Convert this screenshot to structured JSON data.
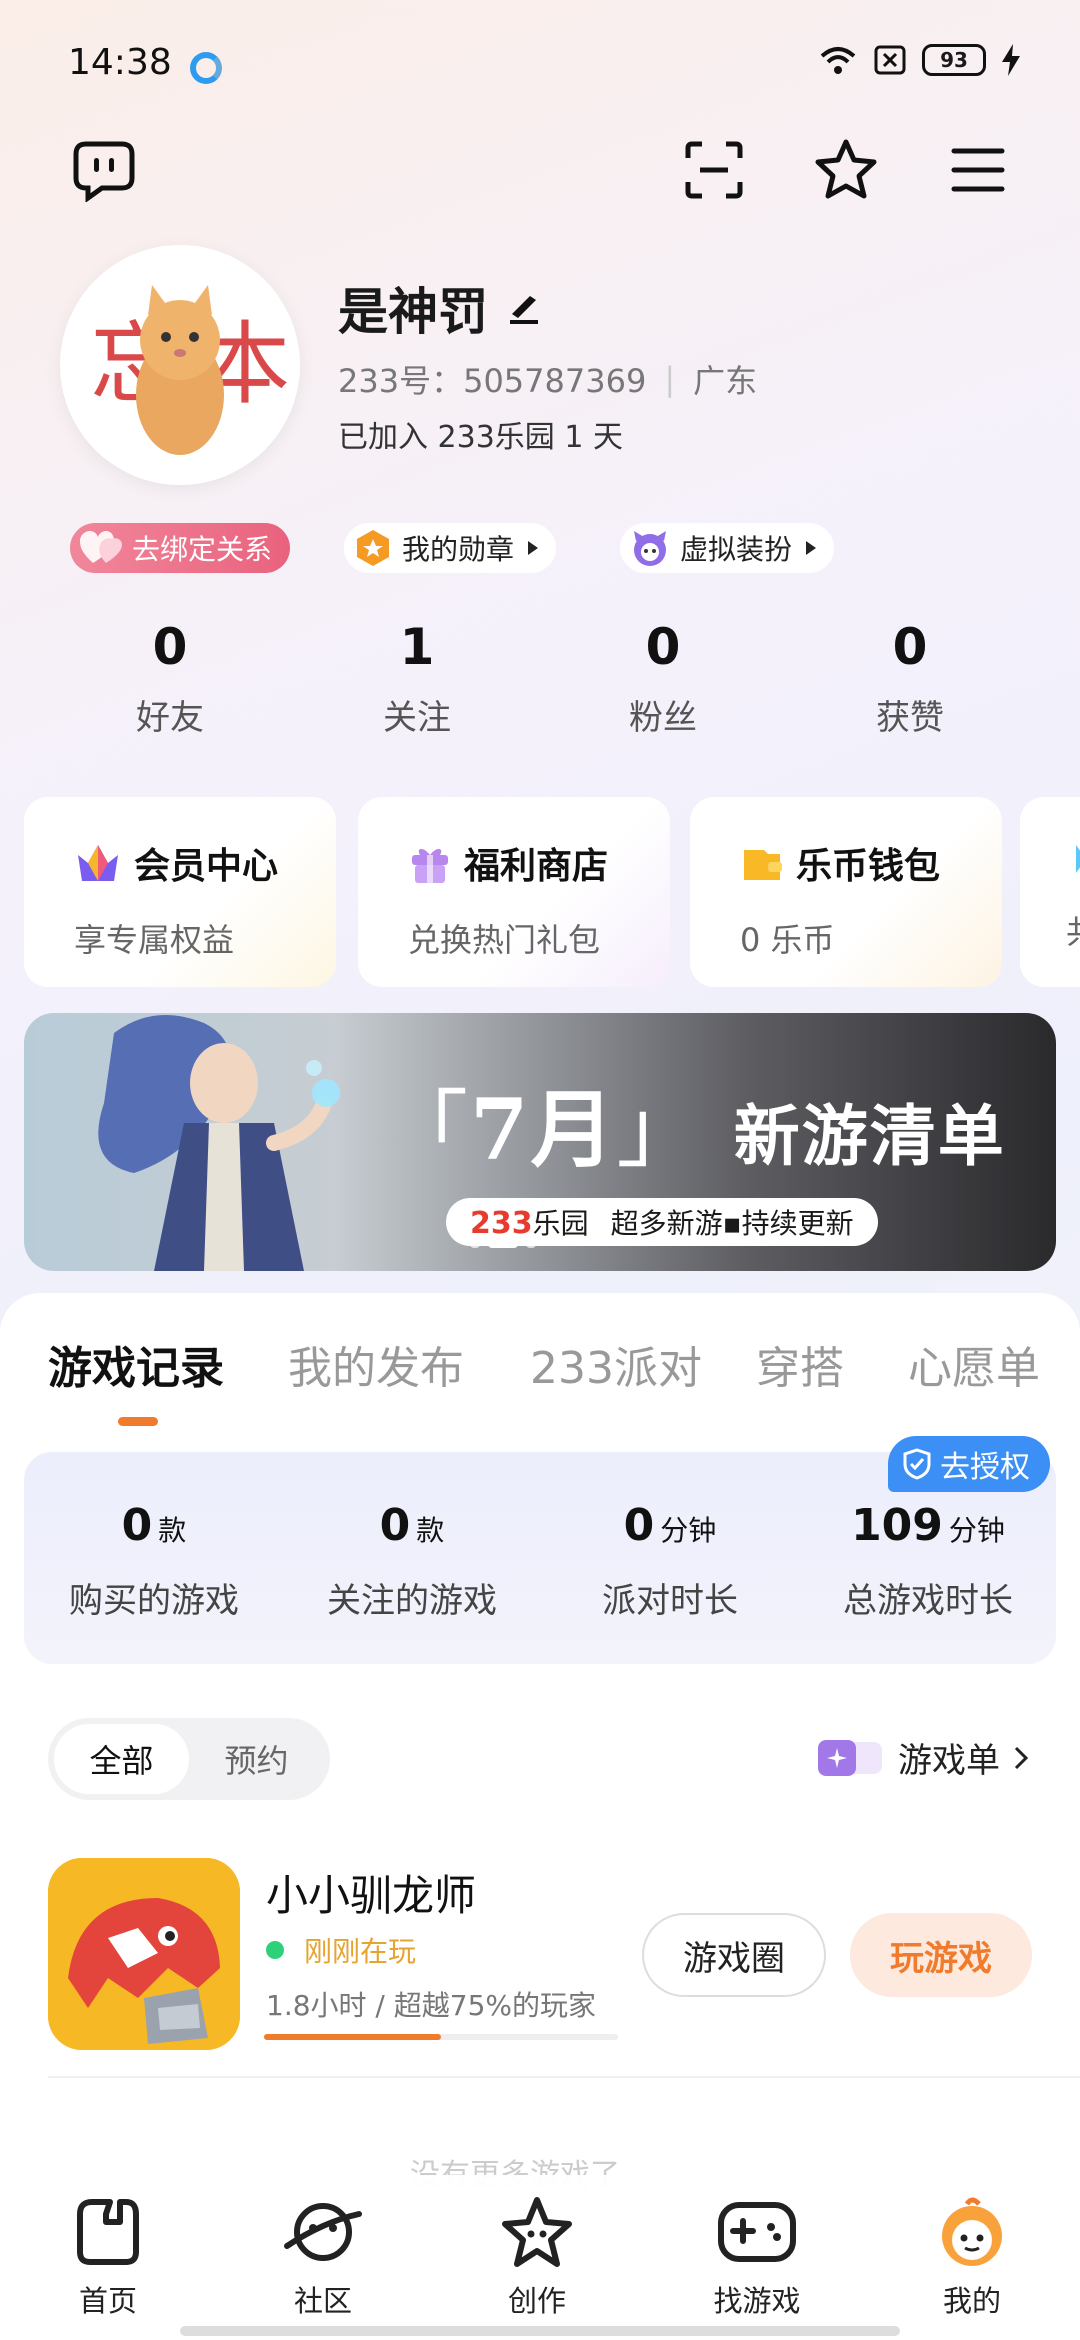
{
  "status_bar": {
    "time": "14:38",
    "battery": "93"
  },
  "profile": {
    "nickname": "是神罚",
    "id_text": "233号：505787369",
    "region": "广东",
    "joined": "已加入 233乐园 1 天"
  },
  "chips": [
    {
      "label": "去绑定关系"
    },
    {
      "label": "我的勋章"
    },
    {
      "label": "虚拟装扮"
    }
  ],
  "stats": [
    {
      "value": "0",
      "label": "好友"
    },
    {
      "value": "1",
      "label": "关注"
    },
    {
      "value": "0",
      "label": "粉丝"
    },
    {
      "value": "0",
      "label": "获赞"
    }
  ],
  "cards": [
    {
      "title": "会员中心",
      "subtitle": "享专属权益"
    },
    {
      "title": "福利商店",
      "subtitle": "兑换热门礼包"
    },
    {
      "title": "乐币钱包",
      "subtitle": "0 乐币"
    },
    {
      "title": "",
      "subtitle": "共"
    }
  ],
  "banner": {
    "bracket_open": "「",
    "month": "7月",
    "bracket_close": "」",
    "title": "新游清单",
    "brand_num": "233",
    "brand_text": "乐园",
    "tagline": "超多新游▪持续更新"
  },
  "tabs": [
    {
      "label": "游戏记录"
    },
    {
      "label": "我的发布"
    },
    {
      "label": "233派对"
    },
    {
      "label": "穿搭"
    },
    {
      "label": "心愿单"
    }
  ],
  "auth_badge": "去授权",
  "game_stats": [
    {
      "value": "0",
      "unit": "款",
      "label": "购买的游戏"
    },
    {
      "value": "0",
      "unit": "款",
      "label": "关注的游戏"
    },
    {
      "value": "0",
      "unit": "分钟",
      "label": "派对时长"
    },
    {
      "value": "109",
      "unit": "分钟",
      "label": "总游戏时长"
    }
  ],
  "filter": {
    "all": "全部",
    "reserve": "预约"
  },
  "game_list_link": "游戏单",
  "game": {
    "name": "小小驯龙师",
    "status": "刚刚在玩",
    "playtime": "1.8小时 / 超越75%的玩家",
    "progress": 0.5,
    "circle_button": "游戏圈",
    "play_button": "玩游戏"
  },
  "faded_text": "没有更多游戏了",
  "bottom_nav": [
    {
      "label": "首页"
    },
    {
      "label": "社区"
    },
    {
      "label": "创作"
    },
    {
      "label": "找游戏"
    },
    {
      "label": "我的"
    }
  ],
  "colors": {
    "accent": "#f07b2c",
    "auth_blue": "#3b8ff5",
    "chip_pink": "#e9627e"
  }
}
